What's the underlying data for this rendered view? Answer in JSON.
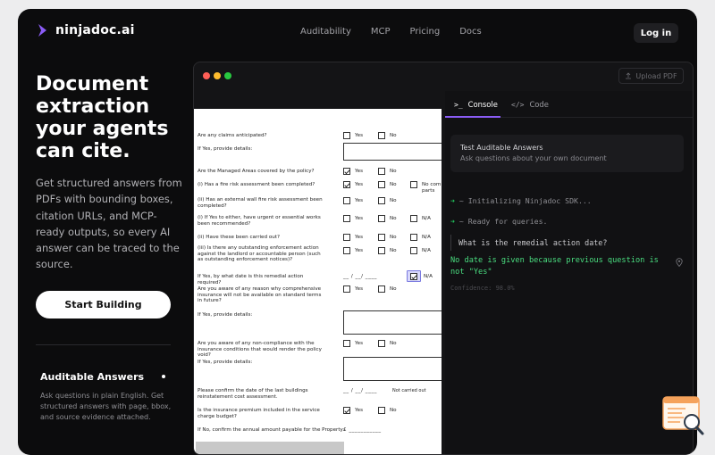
{
  "brand": {
    "name": "ninjadoc.ai",
    "accent": "#8b5cf6"
  },
  "nav": {
    "links": [
      "Auditability",
      "MCP",
      "Pricing",
      "Docs"
    ],
    "login_label": "Log in"
  },
  "hero": {
    "heading": "Document extraction your agents can cite.",
    "description": "Get structured answers from PDFs with bounding boxes, citation URLs, and MCP-ready outputs, so every AI answer can be traced to the source.",
    "cta_label": "Start Building"
  },
  "feature": {
    "title": "Auditable Answers",
    "description": "Ask questions in plain English. Get structured answers with page, bbox, and source evidence attached."
  },
  "demo": {
    "upload_label": "Upload PDF",
    "tabs": {
      "console": "Console",
      "code": "Code"
    },
    "card_title": "Test Auditable Answers",
    "card_subtitle": "Ask questions about your own document",
    "log_init": "~ Initializing Ninjadoc SDK...",
    "log_ready": "~ Ready for queries.",
    "user_question": "What is the remedial action date?",
    "answer": "No date is given because previous question is not \"Yes\"",
    "confidence": "Confidence: 98.0%"
  },
  "document": {
    "yes": "Yes",
    "no": "No",
    "na": "N/A",
    "no_comp_a": "No com",
    "no_comp_b": "parts",
    "not_carried": "Not carried out",
    "date_blank": "__ / __/ ____",
    "money_blank": "£ ___________",
    "q1": "Are any claims anticipated?",
    "q2": "If Yes, provide details:",
    "q3": "Are the Managed Areas covered by the policy?",
    "q4": "(i) Has a fire risk assessment been completed?",
    "q5": "(ii) Has an external wall fire risk assessment been completed?",
    "q6": "(i) If Yes to either, have urgent or essential works been recommended?",
    "q7": "(ii) Have these been carried out?",
    "q8": "(iii) Is there any outstanding enforcement action against the landlord or accountable person (such as outstanding enforcement notices)?",
    "q9": "If Yes, by what date is this remedial action required?",
    "q10": "Are you aware of any reason why comprehensive insurance will not be available on standard terms in future?",
    "q11": "If Yes, provide details:",
    "q12": "Are you aware of any non-compliance with the insurance conditions that would render the policy void?",
    "q13": "If Yes, provide details:",
    "q14": "Please confirm the date of the last buildings reinstatement cost assessment.",
    "q15": "Is the insurance premium included in the service charge budget?",
    "q16": "If No, confirm the annual amount payable for the Property:"
  },
  "colors": {
    "traffic_red": "#ff5f57",
    "traffic_yellow": "#febc2e",
    "traffic_green": "#28c840",
    "answer_green": "#4ade80",
    "highlight": "#d8d8fb"
  }
}
